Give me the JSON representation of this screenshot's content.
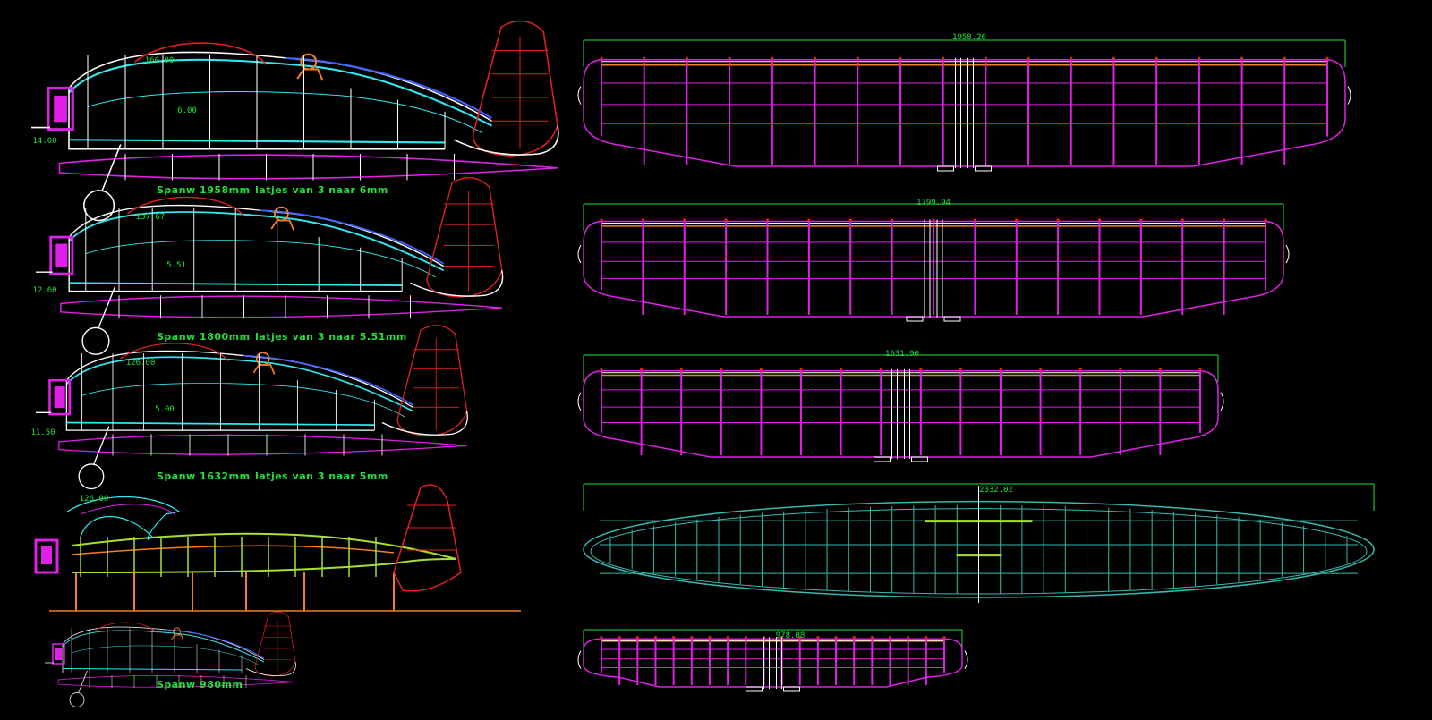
{
  "colors": {
    "background": "#000000",
    "text_green": "#22e03a",
    "magenta": "#e020e8",
    "cyan": "#30e8f0",
    "white": "#ffffff",
    "red": "#e02020",
    "orange": "#f08020",
    "yellow_green": "#a8e030",
    "teal": "#38b8b0",
    "blue": "#4060ff"
  },
  "fuselages": [
    {
      "span_label": "Spanw 1958mm",
      "latjes_label": "latjes van 3 naar 6mm",
      "top_dim": "160.00",
      "mid_dim": "6.00",
      "left_dim": "14.00"
    },
    {
      "span_label": "Spanw 1800mm",
      "latjes_label": "latjes van 3 naar 5.51mm",
      "top_dim": "137.67",
      "mid_dim": "5.51",
      "left_dim": "12.60"
    },
    {
      "span_label": "Spanw 1632mm",
      "latjes_label": "latjes van 3 naar 5mm",
      "top_dim": "126.00",
      "mid_dim": "5.00",
      "left_dim": "11.50"
    },
    {
      "span_label": "",
      "latjes_label": "",
      "top_dim": "126.00",
      "mid_dim": "",
      "left_dim": ""
    },
    {
      "span_label": "Spanw 980mm",
      "latjes_label": "",
      "top_dim": "",
      "mid_dim": "",
      "left_dim": ""
    }
  ],
  "wings": [
    {
      "dimension": "1958.26",
      "color": "magenta",
      "ribs": 17
    },
    {
      "dimension": "1799.94",
      "color": "magenta",
      "ribs": 16
    },
    {
      "dimension": "1631.90",
      "color": "magenta",
      "ribs": 15
    },
    {
      "dimension": "2032.02",
      "color": "teal",
      "ribs": 34
    },
    {
      "dimension": "978.08",
      "color": "magenta",
      "ribs": 19
    }
  ]
}
